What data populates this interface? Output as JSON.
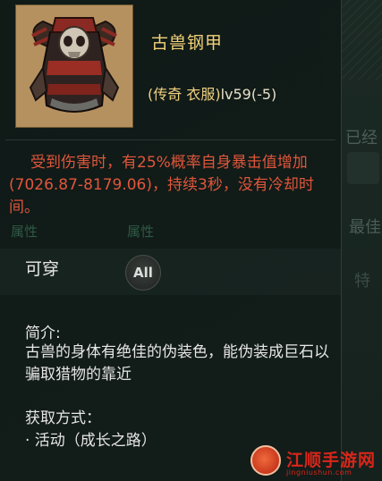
{
  "item": {
    "name": "古兽钢甲",
    "quality": "(传奇 衣服)",
    "level": "lv59(-5)",
    "icon": "chest-armor-icon"
  },
  "effect": {
    "text": "受到伤害时，有25%概率自身暴击值增加(7026.87-8179.06)，持续3秒，没有冷却时间。"
  },
  "wear": {
    "label": "可穿",
    "badge": "All"
  },
  "description": {
    "title": "简介:",
    "text": "古兽的身体有绝佳的伪装色，能伪装成巨石以骗取猎物的靠近"
  },
  "source": {
    "title": "获取方式：",
    "item": "· 活动（成长之路）"
  },
  "background": {
    "already": "已经",
    "best": "最佳",
    "attr": "属性",
    "te": "特"
  },
  "watermark": {
    "title": "江顺手游网",
    "subtitle": "jingniushun.com"
  },
  "colors": {
    "item_name": "#f1d27a",
    "effect": "#e0563b",
    "watermark": "#d8261a"
  }
}
